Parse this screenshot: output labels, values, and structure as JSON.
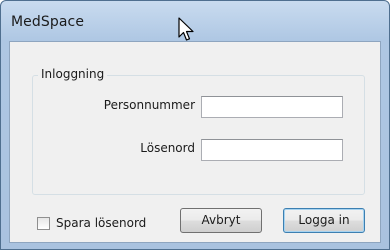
{
  "window": {
    "title": "MedSpace"
  },
  "login_group": {
    "legend": "Inloggning",
    "personnummer_label": "Personnummer",
    "personnummer_value": "",
    "password_label": "Lösenord",
    "password_value": ""
  },
  "save_password": {
    "label": "Spara lösenord",
    "checked": false
  },
  "buttons": {
    "cancel_label": "Avbryt",
    "login_label": "Logga in"
  },
  "colors": {
    "titlebar": "#b9cfe8",
    "client_background": "#f0f0f0",
    "default_button_border": "#3c7fb1"
  }
}
